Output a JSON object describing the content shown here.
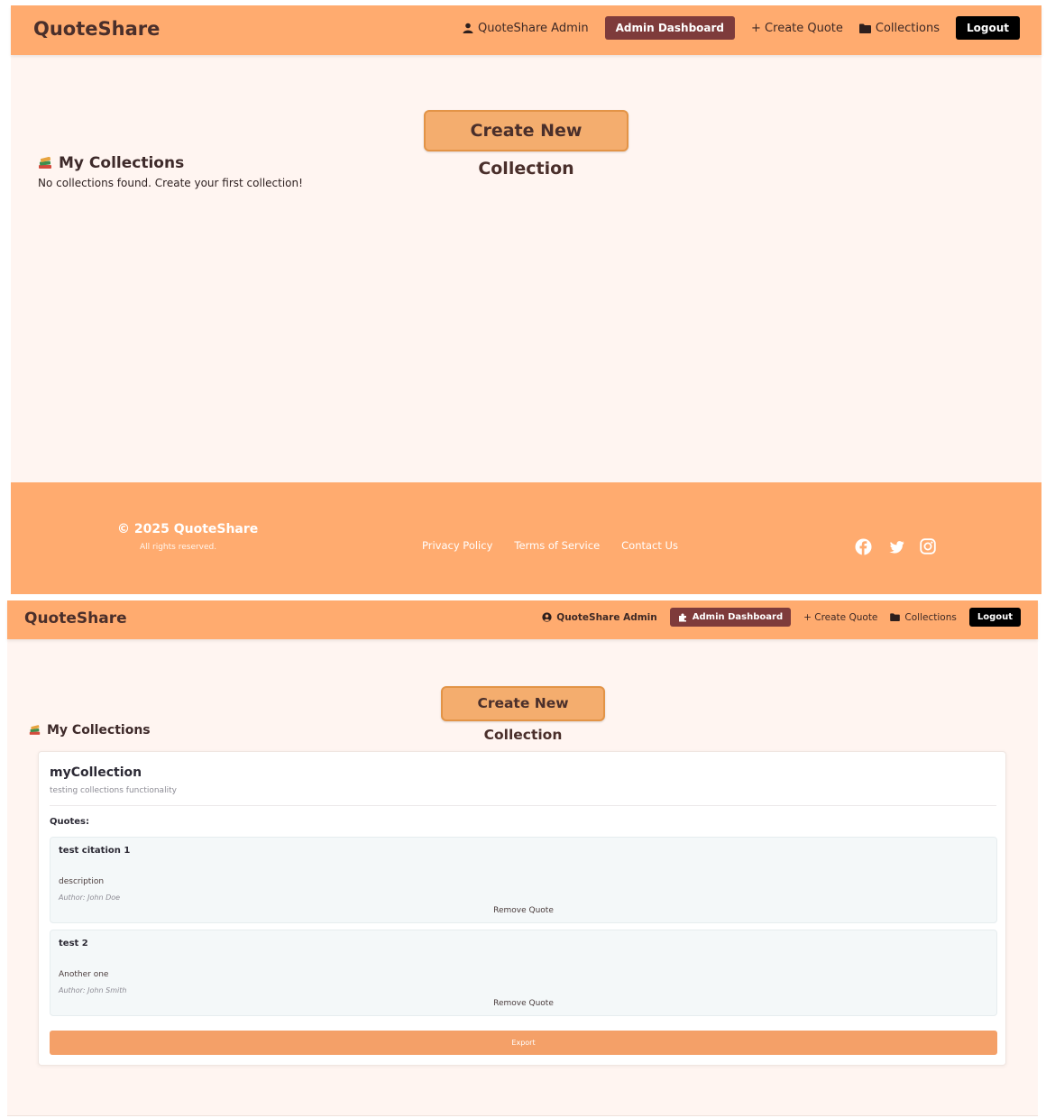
{
  "frame1": {
    "brand": "QuoteShare",
    "nav": {
      "user": "QuoteShare Admin",
      "dashboard": "Admin Dashboard",
      "create_quote": "+ Create Quote",
      "collections": "Collections",
      "logout": "Logout"
    },
    "create_button": "Create New Collection",
    "section_title": "My Collections",
    "empty_message": "No collections found. Create your first collection!",
    "footer": {
      "copyright": "© 2025 QuoteShare",
      "rights": "All rights reserved.",
      "links": [
        "Privacy Policy",
        "Terms of Service",
        "Contact Us"
      ],
      "social_icons": [
        "facebook-icon",
        "twitter-icon",
        "instagram-icon"
      ]
    }
  },
  "frame2": {
    "brand": "QuoteShare",
    "nav": {
      "user": "QuoteShare Admin",
      "dashboard": "Admin Dashboard",
      "create_quote": "+ Create Quote",
      "collections": "Collections",
      "logout": "Logout"
    },
    "create_button": "Create New Collection",
    "section_title": "My Collections",
    "collection": {
      "name": "myCollection",
      "description": "testing collections functionality",
      "quotes_label": "Quotes:",
      "quotes": [
        {
          "title": "test citation 1",
          "description": "description",
          "author": "Author: John Doe",
          "remove": "Remove Quote"
        },
        {
          "title": "test 2",
          "description": "Another one",
          "author": "Author: John Smith",
          "remove": "Remove Quote"
        }
      ],
      "export": "Export"
    }
  },
  "colors": {
    "navbar": "#ffab6f",
    "dashboard_button": "#7e3b3b",
    "page_background": "#fff5f1",
    "create_button": "#f4ad6e",
    "export_button": "#f4a068"
  }
}
